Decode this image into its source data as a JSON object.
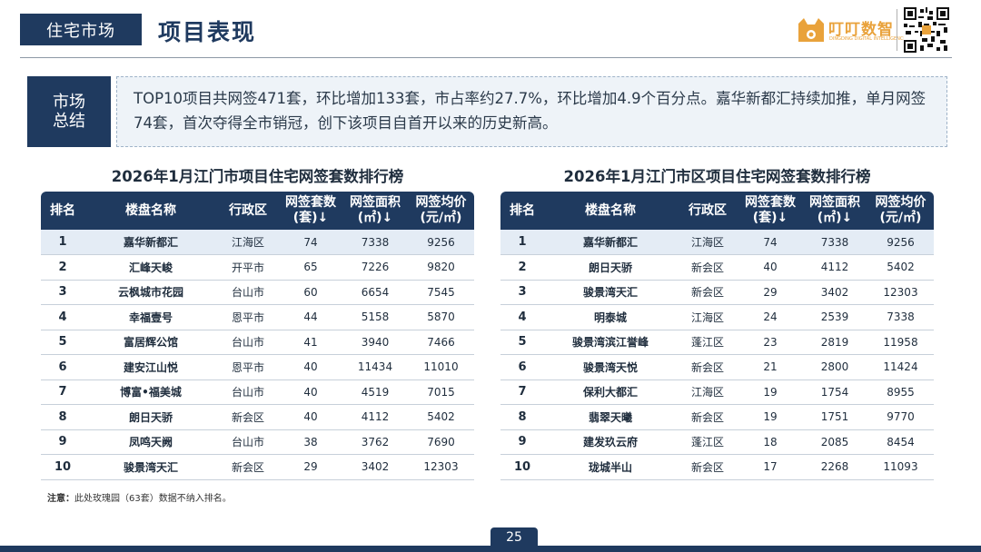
{
  "header": {
    "section_tag": "住宅市场",
    "title": "项目表现",
    "logo_text": "叮叮数智",
    "logo_sub": "DINGDING DIGITAL INTELLIGENCE"
  },
  "summary": {
    "label": "市场总结",
    "text": "TOP10项目共网签471套，环比增加133套，市占率约27.7%，环比增加4.9个百分点。嘉华新都汇持续加推，单月网签74套，首次夺得全市销冠，创下该项目自首开以来的历史新高。"
  },
  "columns": [
    "排名",
    "楼盘名称",
    "行政区",
    "网签套数\n(套)↓",
    "网签面积\n(㎡)↓",
    "网签均价\n(元/㎡)"
  ],
  "left_table": {
    "title": "2026年1月江门市项目住宅网签套数排行榜",
    "rows": [
      [
        "1",
        "嘉华新都汇",
        "江海区",
        "74",
        "7338",
        "9256"
      ],
      [
        "2",
        "汇峰天峻",
        "开平市",
        "65",
        "7226",
        "9820"
      ],
      [
        "3",
        "云枫城市花园",
        "台山市",
        "60",
        "6654",
        "7545"
      ],
      [
        "4",
        "幸福壹号",
        "恩平市",
        "44",
        "5158",
        "5870"
      ],
      [
        "5",
        "富居辉公馆",
        "台山市",
        "41",
        "3940",
        "7466"
      ],
      [
        "6",
        "建安江山悦",
        "恩平市",
        "40",
        "11434",
        "11010"
      ],
      [
        "7",
        "博富•福美城",
        "台山市",
        "40",
        "4519",
        "7015"
      ],
      [
        "8",
        "朗日天骄",
        "新会区",
        "40",
        "4112",
        "5402"
      ],
      [
        "9",
        "凤鸣天阙",
        "台山市",
        "38",
        "3762",
        "7690"
      ],
      [
        "10",
        "骏景湾天汇",
        "新会区",
        "29",
        "3402",
        "12303"
      ]
    ]
  },
  "right_table": {
    "title": "2026年1月江门市区项目住宅网签套数排行榜",
    "rows": [
      [
        "1",
        "嘉华新都汇",
        "江海区",
        "74",
        "7338",
        "9256"
      ],
      [
        "2",
        "朗日天骄",
        "新会区",
        "40",
        "4112",
        "5402"
      ],
      [
        "3",
        "骏景湾天汇",
        "新会区",
        "29",
        "3402",
        "12303"
      ],
      [
        "4",
        "明泰城",
        "江海区",
        "24",
        "2539",
        "7338"
      ],
      [
        "5",
        "骏景湾滨江誉峰",
        "蓬江区",
        "23",
        "2819",
        "11958"
      ],
      [
        "6",
        "骏景湾天悦",
        "新会区",
        "21",
        "2800",
        "11424"
      ],
      [
        "7",
        "保利大都汇",
        "江海区",
        "19",
        "1754",
        "8955"
      ],
      [
        "8",
        "翡翠天曦",
        "新会区",
        "19",
        "1751",
        "9770"
      ],
      [
        "9",
        "建发玖云府",
        "蓬江区",
        "18",
        "2085",
        "8454"
      ],
      [
        "10",
        "珑城半山",
        "新会区",
        "17",
        "2268",
        "11093"
      ]
    ]
  },
  "note": {
    "label": "注意：",
    "text": "此处玫瑰园（63套）数据不纳入排名。"
  },
  "page_number": "25",
  "colors": {
    "primary": "#1f3a5f",
    "accent": "#e9a23b",
    "summary_bg": "#eef3f8",
    "highlight_row": "#e4ecf5"
  },
  "icons": {
    "logo": "cat-logo-icon",
    "qr": "qr-code-icon"
  }
}
